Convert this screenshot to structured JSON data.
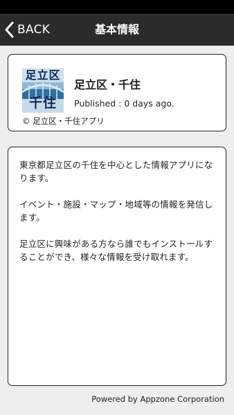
{
  "nav": {
    "back_label": "BACK",
    "title": "基本情報"
  },
  "app": {
    "icon_text_top": "足立区",
    "icon_text_bottom": "千住",
    "name": "足立区・千住",
    "published": "Published : 0 days ago.",
    "copyright": "© 足立区・千住アプリ"
  },
  "description": {
    "paragraphs": [
      "東京都足立区の千住を中心とした情報アプリになります。",
      "イベント・施設・マップ・地域等の情報を発信します。",
      "足立区に興味がある方なら誰でもインストールすることができ、様々な情報を受け取れます。"
    ]
  },
  "footer": {
    "text": "Powered by Appzone Corporation"
  },
  "colors": {
    "nav_bg": "#2b2b2b",
    "page_bg": "#eeeeee",
    "card_border": "#222222"
  }
}
